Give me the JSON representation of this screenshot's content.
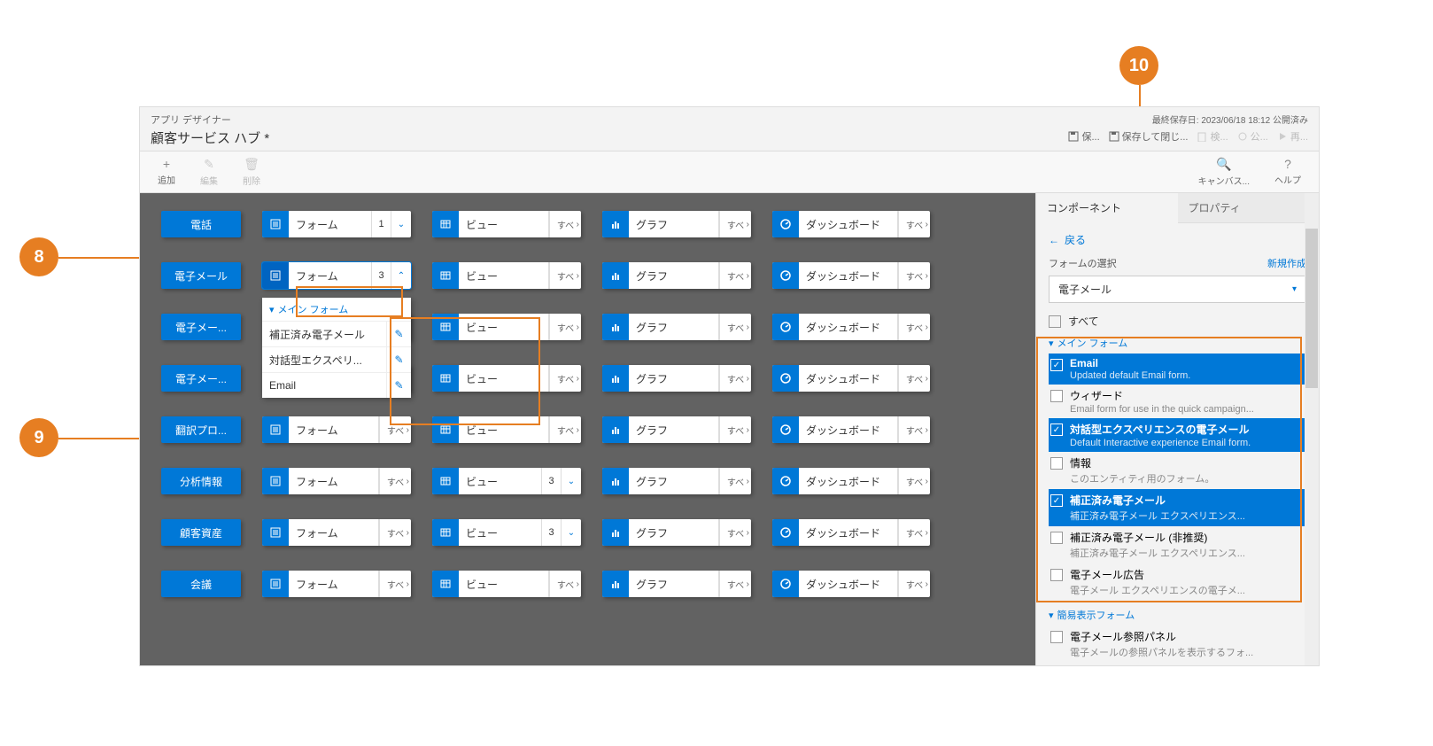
{
  "callouts": {
    "c8": "8",
    "c9": "9",
    "c10": "10"
  },
  "header": {
    "subtitle": "アプリ デザイナー",
    "title": "顧客サービス ハブ *",
    "last_saved": "最終保存日: 2023/06/18 18:12 公開済み",
    "actions": {
      "save": "保...",
      "save_close": "保存して閉じ...",
      "validate": "検...",
      "publish": "公...",
      "play": "再..."
    }
  },
  "toolbar": {
    "add": "追加",
    "edit": "編集",
    "delete": "削除",
    "canvas": "キャンバス...",
    "help": "ヘルプ"
  },
  "entities": [
    "電話",
    "電子メール",
    "電子メー...",
    "電子メー...",
    "翻訳プロ...",
    "分析情報",
    "顧客資産",
    "会議"
  ],
  "tile_labels": {
    "form": "フォーム",
    "view": "ビュー",
    "chart": "グラフ",
    "dash": "ダッシュボード",
    "all": "すべて"
  },
  "form_counts": [
    "1",
    "3",
    "",
    "",
    "",
    "",
    "",
    ""
  ],
  "view_counts": [
    "",
    "",
    "",
    "",
    "",
    "3",
    "3",
    ""
  ],
  "dropdown": {
    "header": "メイン フォーム",
    "items": [
      "補正済み電子メール",
      "対話型エクスペリ...",
      "Email"
    ]
  },
  "panel": {
    "tab_components": "コンポーネント",
    "tab_properties": "プロパティ",
    "back": "戻る",
    "select_label": "フォームの選択",
    "new": "新規作成",
    "entity_selected": "電子メール",
    "check_all": "すべて",
    "group_main": "メイン フォーム",
    "group_quick": "簡易表示フォーム",
    "forms": [
      {
        "checked": true,
        "name": "Email",
        "desc": "Updated default Email form."
      },
      {
        "checked": false,
        "name": "ウィザード",
        "desc": "Email form for use in the quick campaign..."
      },
      {
        "checked": true,
        "name": "対話型エクスペリエンスの電子メール",
        "desc": "Default Interactive experience Email form."
      },
      {
        "checked": false,
        "name": "情報",
        "desc": "このエンティティ用のフォーム。"
      },
      {
        "checked": true,
        "name": "補正済み電子メール",
        "desc": "補正済み電子メール エクスペリエンス..."
      },
      {
        "checked": false,
        "name": "補正済み電子メール (非推奨)",
        "desc": "補正済み電子メール エクスペリエンス..."
      },
      {
        "checked": false,
        "name": "電子メール広告",
        "desc": "電子メール エクスペリエンスの電子メ..."
      }
    ],
    "quick_forms": [
      {
        "checked": false,
        "name": "電子メール参照パネル",
        "desc": "電子メールの参照パネルを表示するフォ..."
      }
    ]
  }
}
